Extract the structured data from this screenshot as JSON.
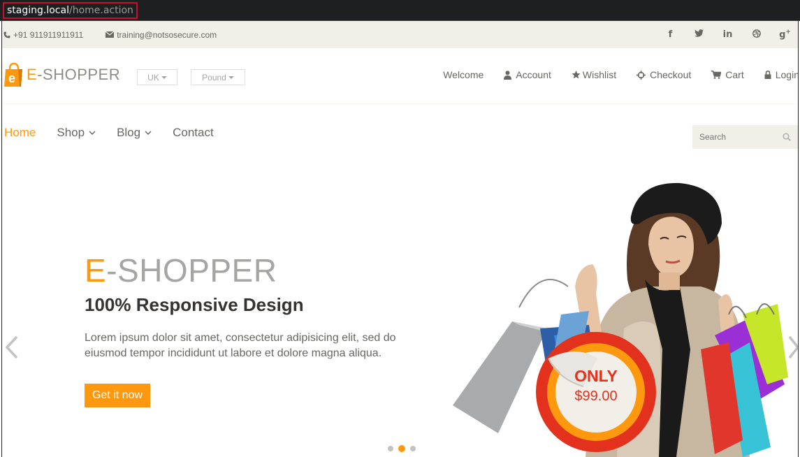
{
  "browser": {
    "url_host": "staging.local",
    "url_path": "/home.action"
  },
  "header_top": {
    "phone": "+91 911911911911",
    "email": "training@notsosecure.com",
    "social": [
      "f",
      "t",
      "in",
      "dribbble",
      "g+"
    ]
  },
  "header_middle": {
    "logo_letter": "e",
    "logo_e": "E",
    "logo_rest": "-SHOPPER",
    "country_label": "UK",
    "currency_label": "Pound",
    "nav": {
      "welcome": "Welcome",
      "account": "Account",
      "wishlist": "Wishlist",
      "checkout": "Checkout",
      "cart": "Cart",
      "login": "Login"
    }
  },
  "mainmenu": {
    "home": "Home",
    "shop": "Shop",
    "blog": "Blog",
    "contact": "Contact"
  },
  "search": {
    "placeholder": "Search"
  },
  "slider": {
    "title_e": "E",
    "title_rest": "-SHOPPER",
    "subtitle": "100% Responsive Design",
    "text": "Lorem ipsum dolor sit amet, consectetur adipisicing elit, sed do eiusmod tempor incididunt ut labore et dolore magna aliqua.",
    "button": "Get it now",
    "badge_only": "ONLY",
    "badge_price": "$99.00",
    "active_slide": 2,
    "slide_count": 3
  },
  "colors": {
    "accent": "#fe980f",
    "badge_red": "#e2321e",
    "topbar_bg": "#f0f0e9"
  }
}
